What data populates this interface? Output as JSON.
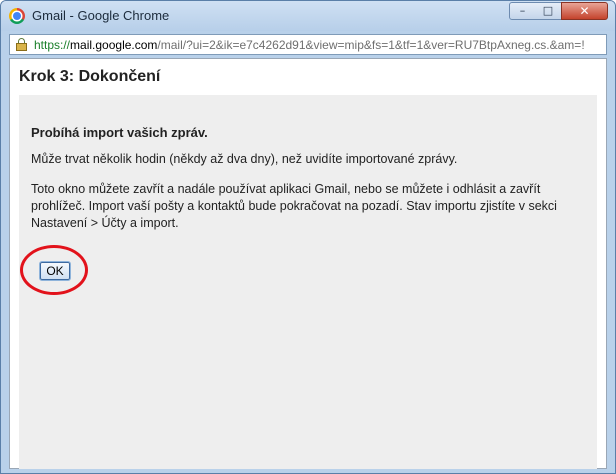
{
  "window": {
    "title": "Gmail - Google Chrome",
    "minimize_glyph": "–",
    "maximize_glyph": "□",
    "close_glyph": "✕"
  },
  "addressbar": {
    "scheme": "https://",
    "domain": "mail.google.com",
    "path": "/mail/?ui=2&ik=e7c4262d91&view=mip&fs=1&tf=1&ver=RU7BtpAxneg.cs.&am=!"
  },
  "dialog": {
    "heading": "Krok 3: Dokončení",
    "bold_line": "Probíhá import vašich zpráv.",
    "paragraph1": "Může trvat několik hodin (někdy až dva dny), než uvidíte importované zprávy.",
    "paragraph2": "Toto okno můžete zavřít a nadále používat aplikaci Gmail, nebo se můžete i odhlásit a zavřít prohlížeč. Import vaší pošty a kontaktů bude pokračovat na pozadí. Stav importu zjistíte v sekci Nastavení > Účty a import.",
    "ok_label": "OK"
  },
  "colors": {
    "highlight_ring": "#e2121b",
    "scheme_green": "#1a7f2a",
    "content_background": "#eeeeee"
  }
}
